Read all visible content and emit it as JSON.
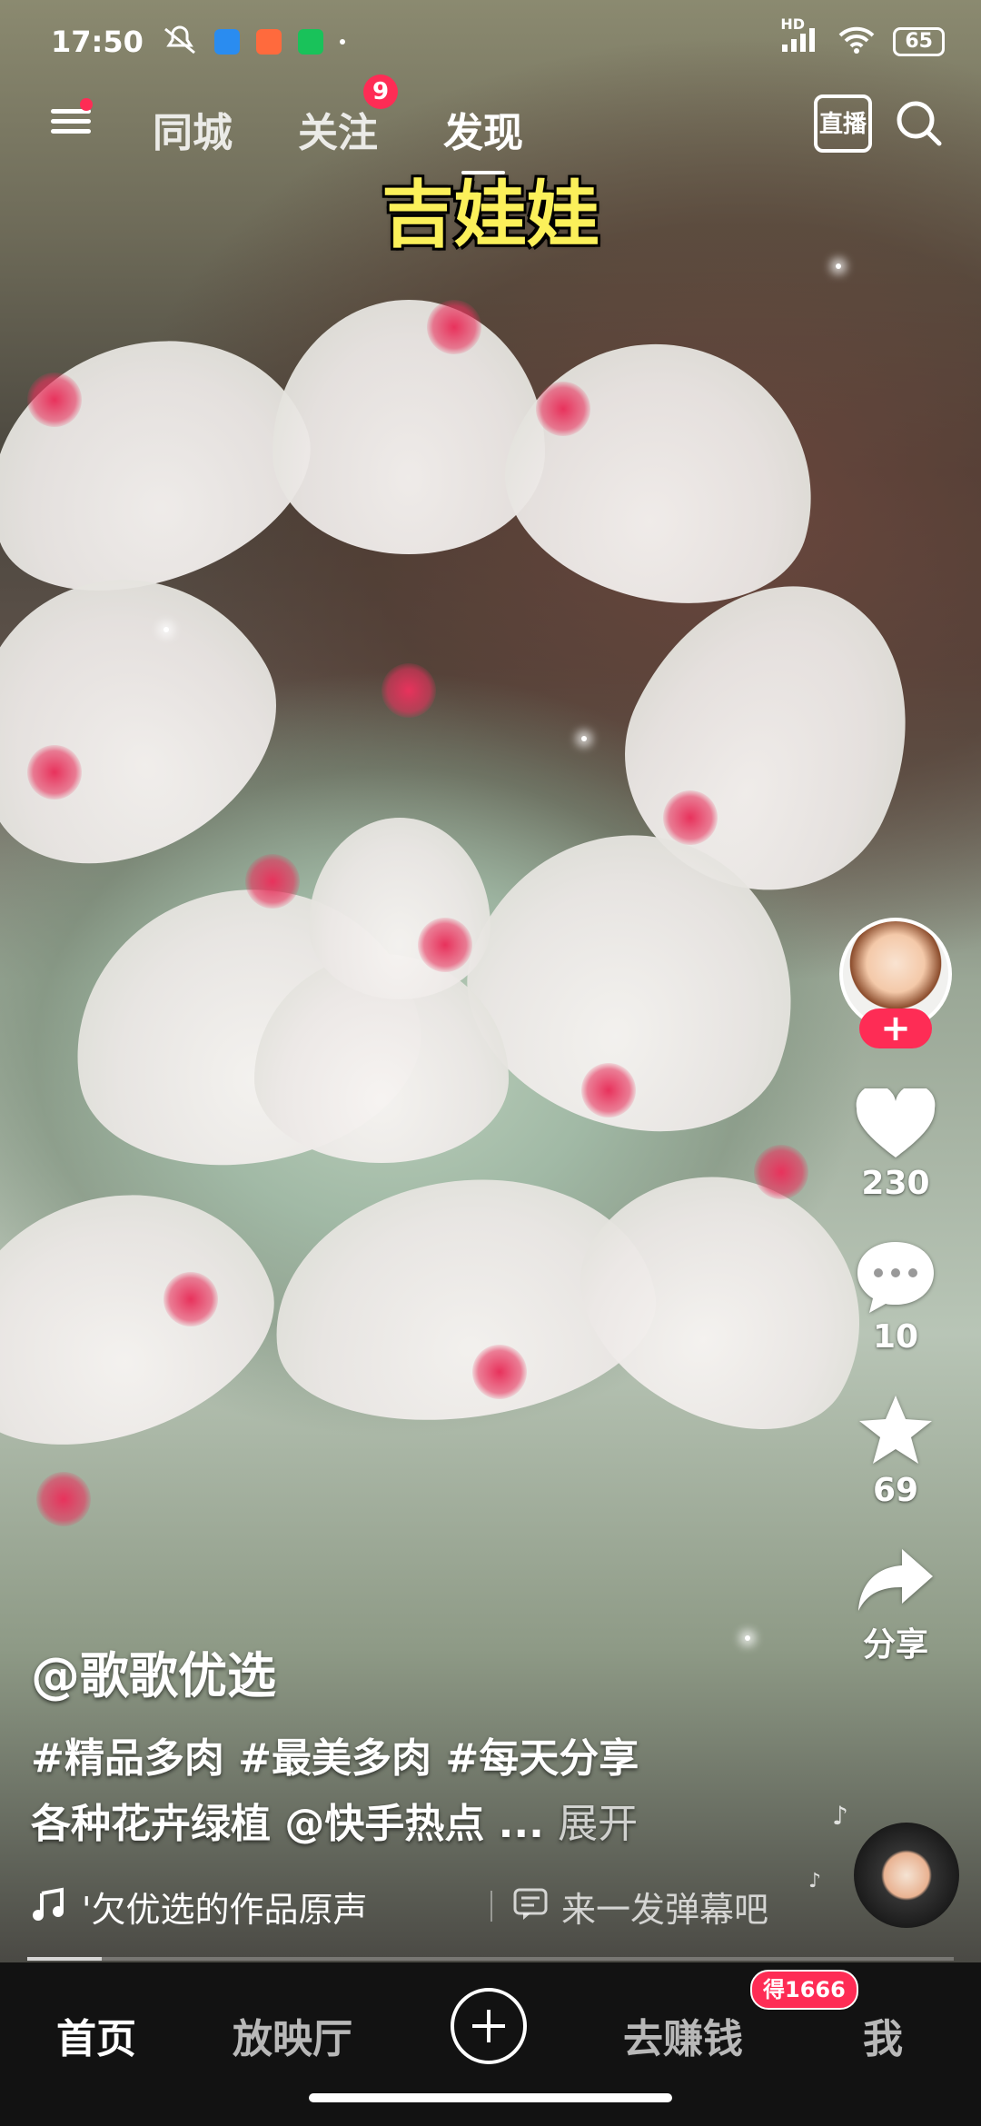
{
  "status_bar": {
    "time": "17:50",
    "network": "HD",
    "battery": "65",
    "icons_left": [
      "mute-icon",
      "app-icon-blue",
      "app-icon-orange",
      "app-icon-green",
      "dot-icon"
    ],
    "icons_right": [
      "signal-icon",
      "wifi-icon",
      "battery-icon"
    ]
  },
  "top_nav": {
    "tabs": [
      {
        "label": "同城"
      },
      {
        "label": "关注",
        "badge": "9"
      },
      {
        "label": "发现",
        "active": true
      }
    ],
    "live_label": "直播"
  },
  "video": {
    "overlay_title": "吉娃娃"
  },
  "actions": {
    "likes": "230",
    "comments": "10",
    "favorites": "69",
    "share_label": "分享"
  },
  "post": {
    "author": "@歌歌优选",
    "desc_line1": "#精品多肉 #最美多肉 #每天分享",
    "desc_line2": "各种花卉绿植 @快手热点 ...",
    "expand_label": "展开",
    "music": "'欠优选的作品原声",
    "danmaku_placeholder": "来一发弹幕吧",
    "progress": 0.08
  },
  "bottom_nav": {
    "items": [
      {
        "label": "首页",
        "active": true
      },
      {
        "label": "放映厅"
      },
      {
        "label": "去赚钱",
        "badge": "得1666"
      },
      {
        "label": "我"
      }
    ]
  },
  "colors": {
    "accent": "#fe2c55",
    "overlay_text": "#fbf05a",
    "nav_bg": "#121212"
  }
}
